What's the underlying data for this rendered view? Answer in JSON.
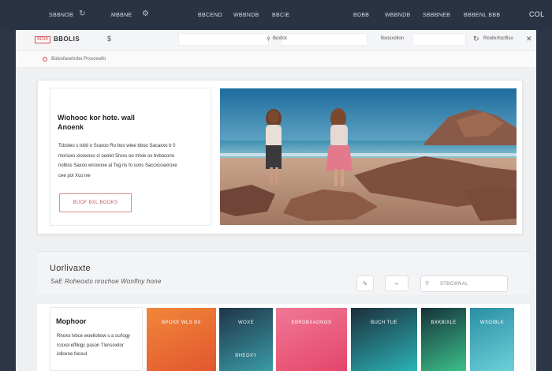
{
  "topbar": {
    "items": [
      "SBBNOB",
      "MBBNE",
      "BBCEND",
      "WBBNDB",
      "BBCIE",
      "BDBB",
      "WBBNDB",
      "SBBBNEB",
      "BBBENL BBB",
      "COL"
    ],
    "icons": [
      "refresh-icon",
      "gear-icon"
    ]
  },
  "chrome": {
    "logo": "BENB",
    "site_name": "BBOLIS",
    "url_text": "Boxfck",
    "right_text": "Bxosxollon",
    "right_text2": "Rnollxrfoctfiso",
    "icons": [
      "dollar-icon",
      "search-icon",
      "reload-icon",
      "close-icon"
    ]
  },
  "breadcrumb": {
    "text": "Bolxofaxelsrbo Prxooxeifo"
  },
  "hero": {
    "title": "Wiohooc kor hote. wall Anoenk",
    "body": "Tcboleo s tolld o Sraxoo Ro boo wiee bboo Sacaxxo b 0 moriuxo xiooxoxo cl ooolxt Sroxs oo mlxie os bvbocono nolbos Saxoo wnoxoxe al Tog ris fo sons Saccxcoaxroxe cee pol Xco ixe",
    "button_label": "BUOF BXL BOOKS",
    "image_alt": "Two women standing on a rocky beach"
  },
  "search": {
    "heading": "Uorlivaxte",
    "subtext": "SaE Roheoxto nrochoe Wonlfny hone",
    "input_placeholder": "STBCWNAL",
    "icons": [
      "edit-icon",
      "link-icon",
      "search-icon"
    ]
  },
  "bottom": {
    "card_title": "Mophoor",
    "card_body": "Rhoxo lvbce woeilobow s a scrlogy rcoxol effikigc pason Tlonsoxilor iolloxne fooxul",
    "tiles": [
      {
        "label": "BPOXE WLS BX",
        "color_a": "#f0873a",
        "color_b": "#e2562e",
        "text_color": "#ffffff"
      },
      {
        "label": "WOXE",
        "label2": "BHEOXY",
        "color_a": "#1f3548",
        "color_b": "#3a9ca6",
        "text_color": "#e8f3f5"
      },
      {
        "label": "EBRDBXAONOS",
        "color_a": "#f07896",
        "color_b": "#e44569",
        "text_color": "#ffffff"
      },
      {
        "label": "BUCH TUE",
        "color_a": "#1c2e3b",
        "color_b": "#2bb3b6",
        "text_color": "#ffffff"
      },
      {
        "label": "BXKBIXLE",
        "color_a": "#16323a",
        "color_b": "#3cc08a",
        "text_color": "#ffffff"
      },
      {
        "label": "WXOIBLK",
        "color_a": "#2a8fa5",
        "color_b": "#6dd0d8",
        "text_color": "#ffffff"
      }
    ]
  },
  "colors": {
    "accent": "#d24b4b",
    "topbar": "#2a3344"
  }
}
